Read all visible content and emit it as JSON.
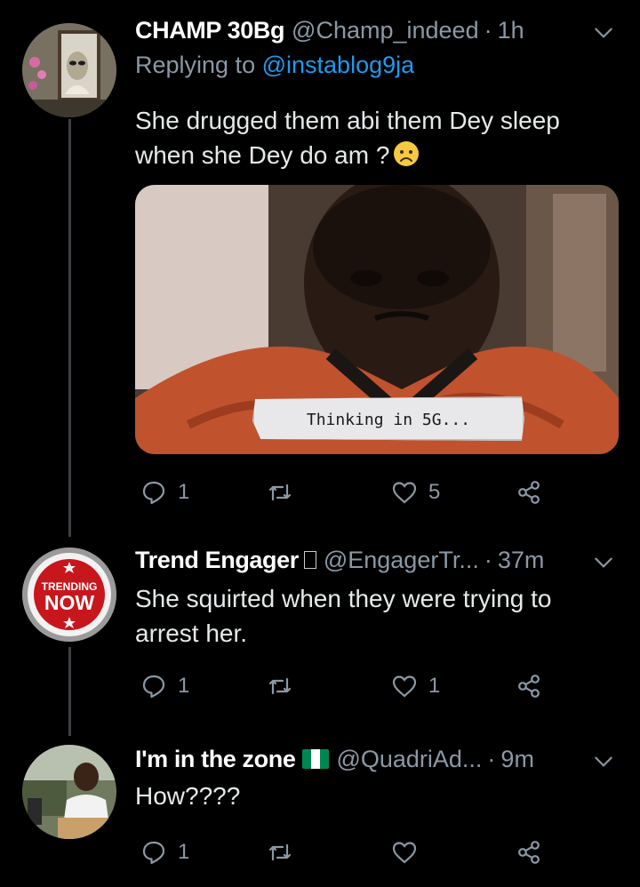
{
  "tweets": [
    {
      "name": "CHAMP 30Bg",
      "handle": "@Champ_indeed",
      "separator": "·",
      "time": "1h",
      "replying_prefix": "Replying to",
      "replying_to": "@instablog9ja",
      "text_line1": "She drugged them abi them Dey sleep",
      "text_line2": "when she Dey do am ?",
      "emoji": "worried-face-emoji",
      "media": {
        "caption": "Thinking in 5G..."
      },
      "actions": {
        "reply_count": "1",
        "retweet_count": "",
        "like_count": "5"
      }
    },
    {
      "name": "Trend Engager",
      "name_suffix_glyph": "unknown-glyph-box",
      "handle": "@EngagerTr...",
      "separator": "·",
      "time": "37m",
      "avatar_text_top": "TRENDING",
      "avatar_text_bottom": "NOW",
      "text_line1": "She squirted when they were trying to",
      "text_line2": "arrest her.",
      "actions": {
        "reply_count": "1",
        "retweet_count": "",
        "like_count": "1"
      }
    },
    {
      "name": "I'm in the zone",
      "flag": "nigeria-flag",
      "handle": "@QuadriAd...",
      "separator": "·",
      "time": "9m",
      "text_line1": "How????",
      "actions": {
        "reply_count": "1",
        "retweet_count": "",
        "like_count": ""
      }
    }
  ],
  "colors": {
    "background": "#000000",
    "text": "#e6e9ea",
    "muted": "#8b98a5",
    "link": "#1d9bf0",
    "thread_line": "#3d4145",
    "nigeria_green": "#008751",
    "trending_red": "#c8161d"
  }
}
